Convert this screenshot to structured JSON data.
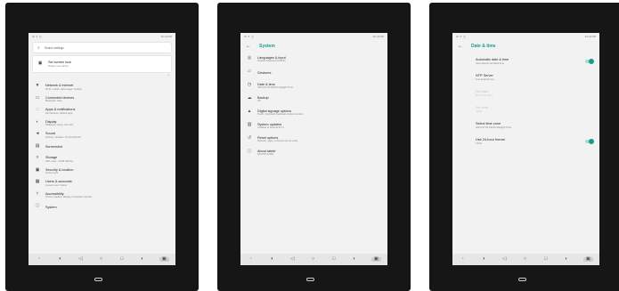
{
  "colors": {
    "accent": "#199c8a",
    "device_bezel": "#161616",
    "screen_bg": "#f2f2f2",
    "navbar_bg": "#e6e6e6"
  },
  "screens": [
    {
      "status": {
        "icons": [
          "⊞",
          "▾",
          "◫"
        ],
        "time": "4G 22:06"
      },
      "search_placeholder": "Search settings",
      "suggestion": {
        "icon": "lock-icon",
        "title": "Set screen lock",
        "subtitle": "Protect your device"
      },
      "items": [
        {
          "icon": "wifi-icon",
          "title": "Network & internet",
          "subtitle": "Wi-Fi, mobile, data usage, hotspot"
        },
        {
          "icon": "devices-icon",
          "title": "Connected devices",
          "subtitle": "Bluetooth, Cast"
        },
        {
          "icon": "apps-icon",
          "title": "Apps & notifications",
          "subtitle": "Permissions, default apps"
        },
        {
          "icon": "brightness-icon",
          "title": "Display",
          "subtitle": "Wallpaper, sleep, font size"
        },
        {
          "icon": "volume-icon",
          "title": "Sound",
          "subtitle": "Volume, vibration, Do Not Disturb"
        },
        {
          "icon": "screenshot-icon",
          "title": "Screenshot",
          "subtitle": ""
        },
        {
          "icon": "storage-icon",
          "title": "Storage",
          "subtitle": "32% used - 10.85 GB free"
        },
        {
          "icon": "security-icon",
          "title": "Security & location",
          "subtitle": "Screen lock"
        },
        {
          "icon": "accounts-icon",
          "title": "Users & accounts",
          "subtitle": "Current user: Owner"
        },
        {
          "icon": "accessibility-icon",
          "title": "Accessibility",
          "subtitle": "Screen readers, display, interaction controls"
        },
        {
          "icon": "system-icon",
          "title": "System",
          "subtitle": ""
        }
      ]
    },
    {
      "status": {
        "icons": [
          "⊞",
          "▾",
          "◫"
        ],
        "time": "4G 22:06"
      },
      "title": "System",
      "items": [
        {
          "icon": "globe-icon",
          "title": "Languages & input",
          "subtitle": "Android Keyboard (AOSP)"
        },
        {
          "icon": "gesture-icon",
          "title": "Gestures",
          "subtitle": ""
        },
        {
          "icon": "clock-icon",
          "title": "Date & time",
          "subtitle": "GMT+01:00 Pacific Daylight Time"
        },
        {
          "icon": "backup-icon",
          "title": "Backup",
          "subtitle": "Off"
        },
        {
          "icon": "signage-icon",
          "title": "Digital signage options",
          "subtitle": "Touch, Keyboard, hardware buttons control"
        },
        {
          "icon": "update-icon",
          "title": "System updates",
          "subtitle": "Updated to Android 8.1.0"
        },
        {
          "icon": "reset-icon",
          "title": "Reset options",
          "subtitle": "Network, apps, or device can be reset"
        },
        {
          "icon": "info-icon",
          "title": "About tablet",
          "subtitle": "AD-DTP-10001"
        }
      ]
    },
    {
      "status": {
        "icons": [
          "⊞",
          "▾",
          "◫"
        ],
        "time": "4G 22:06"
      },
      "title": "Date & time",
      "items": [
        {
          "title": "Automatic date & time",
          "subtitle": "Use network-provided time",
          "toggle": true
        },
        {
          "title": "NTP Server",
          "subtitle": "time.android.com"
        },
        {
          "title": "Set date",
          "subtitle": "March 22, 2024",
          "disabled": true
        },
        {
          "title": "Set time",
          "subtitle": "22:06",
          "disabled": true
        },
        {
          "title": "Select time zone",
          "subtitle": "GMT+07:00 Pacific Daylight Time"
        },
        {
          "title": "Use 24-hour format",
          "subtitle": "13:00",
          "toggle": true
        }
      ]
    }
  ],
  "navbar": [
    {
      "name": "volume-down-icon",
      "glyph": "◦"
    },
    {
      "name": "volume-up-icon",
      "glyph": "◑"
    },
    {
      "name": "back-icon",
      "glyph": "◁"
    },
    {
      "name": "home-icon",
      "glyph": "○"
    },
    {
      "name": "recents-icon",
      "glyph": "□"
    },
    {
      "name": "screenshot-icon",
      "glyph": "◐"
    },
    {
      "name": "menu-icon",
      "glyph": "▣",
      "selected": true
    }
  ]
}
